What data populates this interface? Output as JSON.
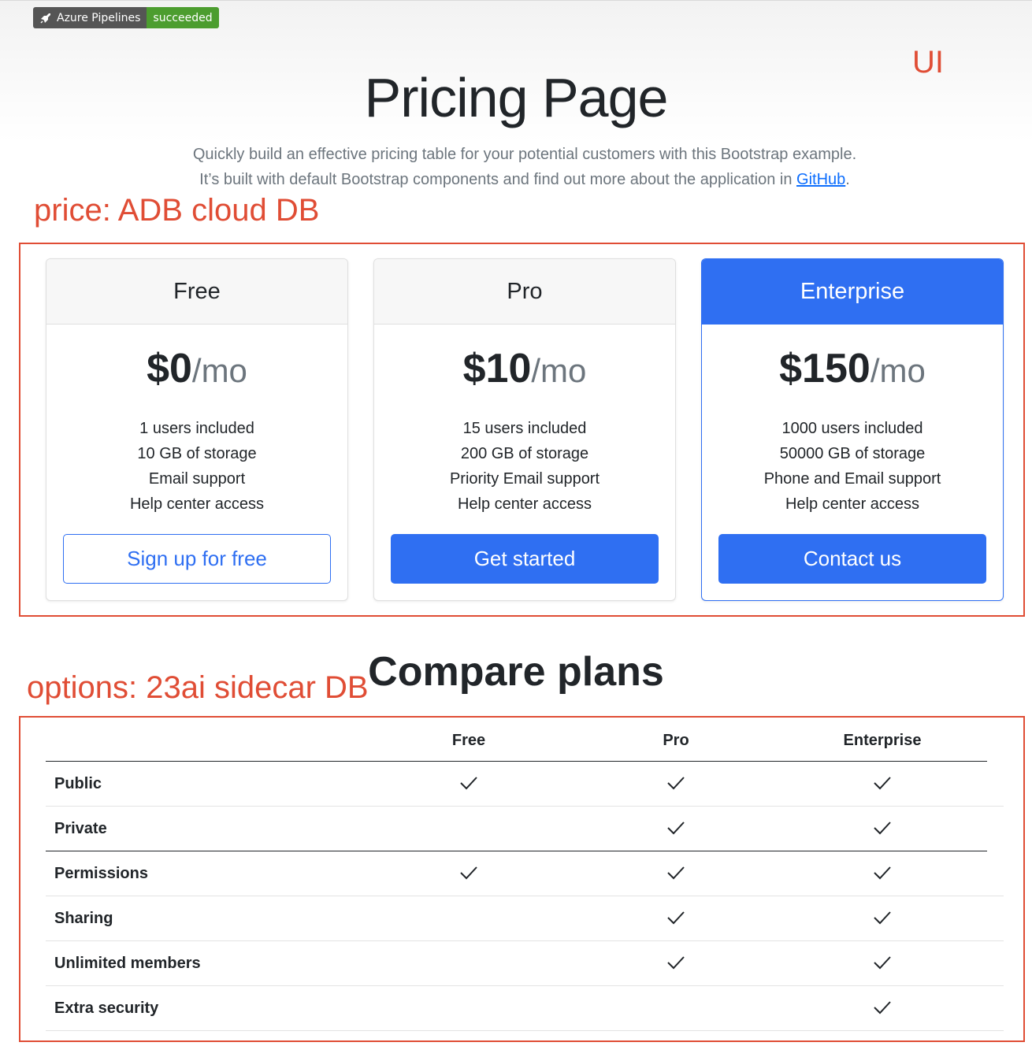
{
  "badge": {
    "left": "Azure Pipelines",
    "right": "succeeded"
  },
  "annotations": {
    "ui": "UI",
    "price": "price: ADB cloud DB",
    "options": "options: 23ai sidecar DB"
  },
  "hero": {
    "title": "Pricing Page",
    "lead_pre": "Quickly build an effective pricing table for your potential customers with this Bootstrap example. It’s built with default Bootstrap components and find out more about the application in ",
    "lead_link": "GitHub",
    "lead_post": "."
  },
  "plans": [
    {
      "name": "Free",
      "amount": "$0",
      "per": "/mo",
      "features": [
        "1 users included",
        "10 GB of storage",
        "Email support",
        "Help center access"
      ],
      "button": "Sign up for free"
    },
    {
      "name": "Pro",
      "amount": "$10",
      "per": "/mo",
      "features": [
        "15 users included",
        "200 GB of storage",
        "Priority Email support",
        "Help center access"
      ],
      "button": "Get started"
    },
    {
      "name": "Enterprise",
      "amount": "$150",
      "per": "/mo",
      "features": [
        "1000 users included",
        "50000 GB of storage",
        "Phone and Email support",
        "Help center access"
      ],
      "button": "Contact us"
    }
  ],
  "compare": {
    "title": "Compare plans",
    "columns": [
      "Free",
      "Pro",
      "Enterprise"
    ],
    "rows": [
      {
        "label": "Public",
        "checks": [
          true,
          true,
          true
        ]
      },
      {
        "label": "Private",
        "checks": [
          false,
          true,
          true
        ]
      },
      {
        "label": "Permissions",
        "checks": [
          true,
          true,
          true
        ]
      },
      {
        "label": "Sharing",
        "checks": [
          false,
          true,
          true
        ]
      },
      {
        "label": "Unlimited members",
        "checks": [
          false,
          true,
          true
        ]
      },
      {
        "label": "Extra security",
        "checks": [
          false,
          false,
          true
        ]
      }
    ]
  },
  "colors": {
    "primary": "#2f6ff2",
    "annotation": "#e04d35",
    "badge_success": "#4c9d2f"
  }
}
